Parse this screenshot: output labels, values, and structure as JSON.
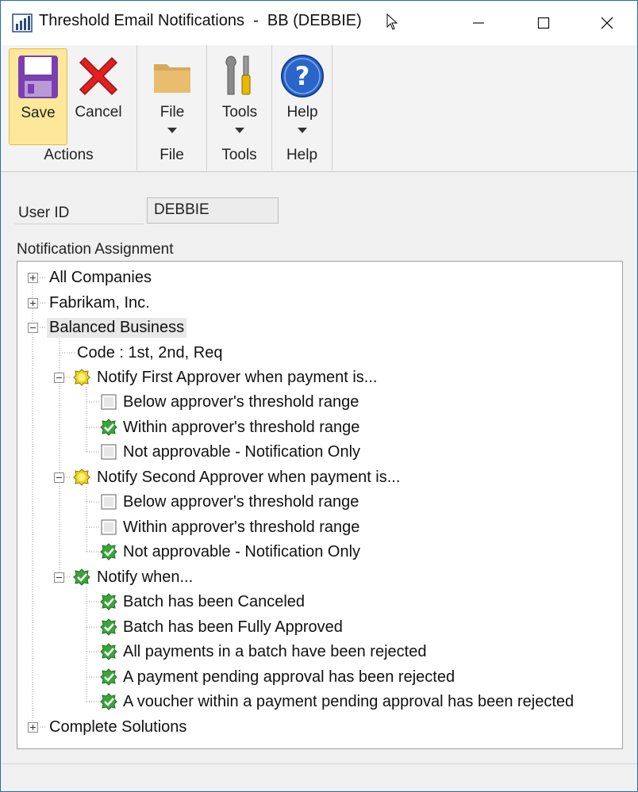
{
  "window": {
    "title": "Threshold Email Notifications  -  BB (DEBBIE)"
  },
  "ribbon": {
    "groups": [
      {
        "label": "Actions",
        "buttons": [
          {
            "label": "Save",
            "icon": "save-icon"
          },
          {
            "label": "Cancel",
            "icon": "cancel-icon"
          }
        ]
      },
      {
        "label": "File",
        "buttons": [
          {
            "label": "File",
            "icon": "folder-icon"
          }
        ]
      },
      {
        "label": "Tools",
        "buttons": [
          {
            "label": "Tools",
            "icon": "tools-icon"
          }
        ]
      },
      {
        "label": "Help",
        "buttons": [
          {
            "label": "Help",
            "icon": "help-icon"
          }
        ]
      }
    ]
  },
  "form": {
    "user_id_label": "User ID",
    "user_id_value": "DEBBIE",
    "assignment_label": "Notification Assignment"
  },
  "tree": {
    "all_companies": "All Companies",
    "fabrikam": "Fabrikam, Inc.",
    "balanced_business": "Balanced Business",
    "code": "Code : 1st, 2nd, Req",
    "first_approver": {
      "label": "Notify First Approver when payment is...",
      "items": [
        {
          "label": "Below approver's threshold range",
          "checked": false
        },
        {
          "label": "Within approver's threshold range",
          "checked": true
        },
        {
          "label": "Not approvable - Notification Only",
          "checked": false
        }
      ]
    },
    "second_approver": {
      "label": "Notify Second Approver when payment is...",
      "items": [
        {
          "label": "Below approver's threshold range",
          "checked": false
        },
        {
          "label": "Within approver's threshold range",
          "checked": false
        },
        {
          "label": "Not approvable - Notification Only",
          "checked": true
        }
      ]
    },
    "notify_when": {
      "label": "Notify when...",
      "items": [
        {
          "label": "Batch has been Canceled",
          "checked": true
        },
        {
          "label": "Batch has been Fully Approved",
          "checked": true
        },
        {
          "label": "All payments in a batch have been rejected",
          "checked": true
        },
        {
          "label": "A payment pending approval has been rejected",
          "checked": true
        },
        {
          "label": "A voucher within a payment pending approval has been rejected",
          "checked": true
        }
      ]
    },
    "complete_solutions": "Complete Solutions"
  },
  "colors": {
    "accent": "#1f6fb5",
    "check_green": "#3aa43a",
    "partial_yellow": "#f2d21a",
    "selected_button": "#fde89a"
  }
}
